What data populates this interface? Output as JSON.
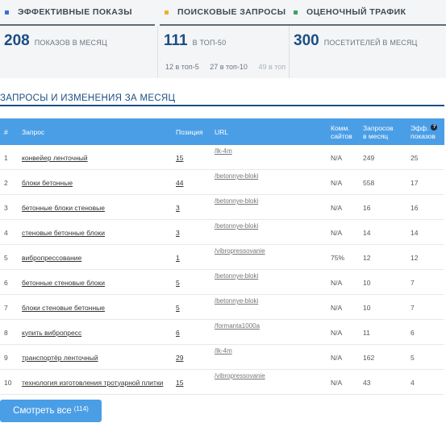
{
  "cards": [
    {
      "title": "ЭФФЕКТИВНЫЕ ПОКАЗЫ",
      "color": "#3b6fd8",
      "number": "208",
      "unit": "ПОКАЗОВ В МЕСЯЦ",
      "subs": []
    },
    {
      "title": "ПОИСКОВЫЕ ЗАПРОСЫ",
      "color": "#e8b22e",
      "number": "111",
      "unit": "В ТОП-50",
      "subs": [
        "12 в топ-5",
        "27 в топ-10",
        "49 в топ"
      ]
    },
    {
      "title": "ОЦЕНОЧНЫЙ ТРАФИК",
      "color": "#3aa65a",
      "number": "300",
      "unit": "ПОСЕТИТЕЛЕЙ В МЕСЯЦ",
      "subs": []
    }
  ],
  "section": {
    "title": "ЗАПРОСЫ И ИЗМЕНЕНИЯ ЗА МЕСЯЦ"
  },
  "table": {
    "headers": {
      "num": "#",
      "query": "Запрос",
      "position": "Позиция",
      "url": "URL",
      "comm_1": "Комм.",
      "comm_2": "сайтов",
      "req_1": "Запросов",
      "req_2": "в месяц",
      "eff_1": "Эфф.",
      "eff_2": "показов",
      "help": "?"
    },
    "rows": [
      {
        "n": "1",
        "query": "конвейер ленточный",
        "position": "15",
        "url": "/lk-4m",
        "comm": "N/A",
        "requests": "249",
        "eff": "25"
      },
      {
        "n": "2",
        "query": "блоки бетонные",
        "position": "44",
        "url": "/betonnye-bloki",
        "comm": "N/A",
        "requests": "558",
        "eff": "17"
      },
      {
        "n": "3",
        "query": "бетонные блоки стеновые",
        "position": "3",
        "url": "/betonnye-bloki",
        "comm": "N/A",
        "requests": "16",
        "eff": "16"
      },
      {
        "n": "4",
        "query": "стеновые бетонные блоки",
        "position": "3",
        "url": "/betonnye-bloki",
        "comm": "N/A",
        "requests": "14",
        "eff": "14"
      },
      {
        "n": "5",
        "query": "вибропрессование",
        "position": "1",
        "url": "/vibropressovanie",
        "comm": "75%",
        "requests": "12",
        "eff": "12"
      },
      {
        "n": "6",
        "query": "бетонные стеновые блоки",
        "position": "5",
        "url": "/betonnye-bloki",
        "comm": "N/A",
        "requests": "10",
        "eff": "7"
      },
      {
        "n": "7",
        "query": "блоки стеновые бетонные",
        "position": "5",
        "url": "/betonnye-bloki",
        "comm": "N/A",
        "requests": "10",
        "eff": "7"
      },
      {
        "n": "8",
        "query": "купить вибропресс",
        "position": "6",
        "url": "/formanta1000a",
        "comm": "N/A",
        "requests": "11",
        "eff": "6"
      },
      {
        "n": "9",
        "query": "транспортёр ленточный",
        "position": "29",
        "url": "/lk-4m",
        "comm": "N/A",
        "requests": "162",
        "eff": "5"
      },
      {
        "n": "10",
        "query": "технология изготовления тротуарной плитки",
        "position": "15",
        "url": "/vibropressovanie",
        "comm": "N/A",
        "requests": "43",
        "eff": "4"
      }
    ]
  },
  "button": {
    "label": "Смотреть все",
    "count": "(114)"
  }
}
